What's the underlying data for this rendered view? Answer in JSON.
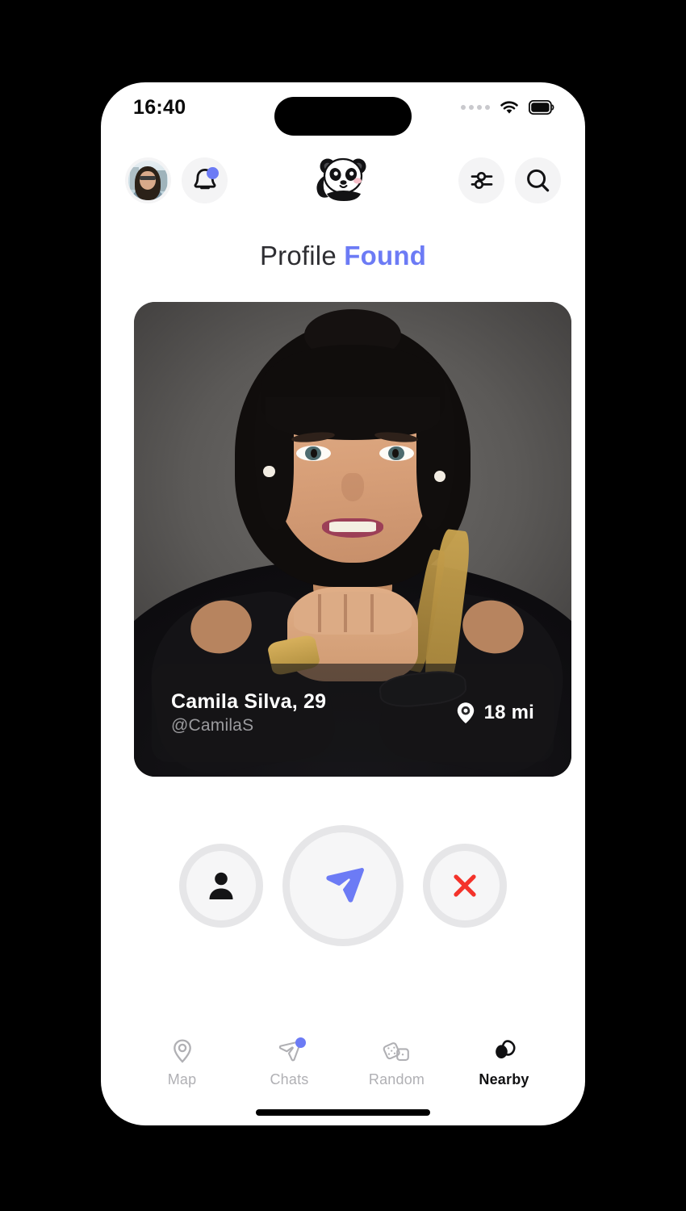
{
  "status_bar": {
    "time": "16:40",
    "signal_icon": "signal-dots-icon",
    "wifi_icon": "wifi-icon",
    "battery_icon": "battery-full-icon"
  },
  "header": {
    "avatar": {
      "name": "profile-avatar",
      "alt": "user avatar"
    },
    "notifications": {
      "icon": "bell-icon",
      "has_badge": true
    },
    "logo": {
      "icon": "panda-logo-icon",
      "alt": "panda logo"
    },
    "filters": {
      "icon": "sliders-filter-icon"
    },
    "search": {
      "icon": "search-icon"
    }
  },
  "title": {
    "plain": "Profile",
    "accent": "Found"
  },
  "profile": {
    "name_age": "Camila Silva, 29",
    "handle": "@CamilaS",
    "distance": "18 mi",
    "distance_icon": "location-pin-icon"
  },
  "actions": [
    {
      "name": "profile-action-button",
      "icon": "person-icon",
      "color": "#141416"
    },
    {
      "name": "send-message-button",
      "icon": "send-plane-icon",
      "color": "#6C7BF5"
    },
    {
      "name": "dismiss-button",
      "icon": "close-x-icon",
      "color": "#F4332B"
    }
  ],
  "bottom_nav": {
    "items": [
      {
        "label": "Map",
        "icon": "map-pin-icon",
        "active": false,
        "badge": false
      },
      {
        "label": "Chats",
        "icon": "send-plane-outline-icon",
        "active": false,
        "badge": true
      },
      {
        "label": "Random",
        "icon": "dice-icon",
        "active": false,
        "badge": false
      },
      {
        "label": "Nearby",
        "icon": "stacked-cards-icon",
        "active": true,
        "badge": false
      }
    ]
  },
  "colors": {
    "accent": "#6C7BF5",
    "danger": "#F4332B",
    "inactive": "#B0B0B4",
    "active": "#101012",
    "chip_bg": "#F4F4F5"
  }
}
